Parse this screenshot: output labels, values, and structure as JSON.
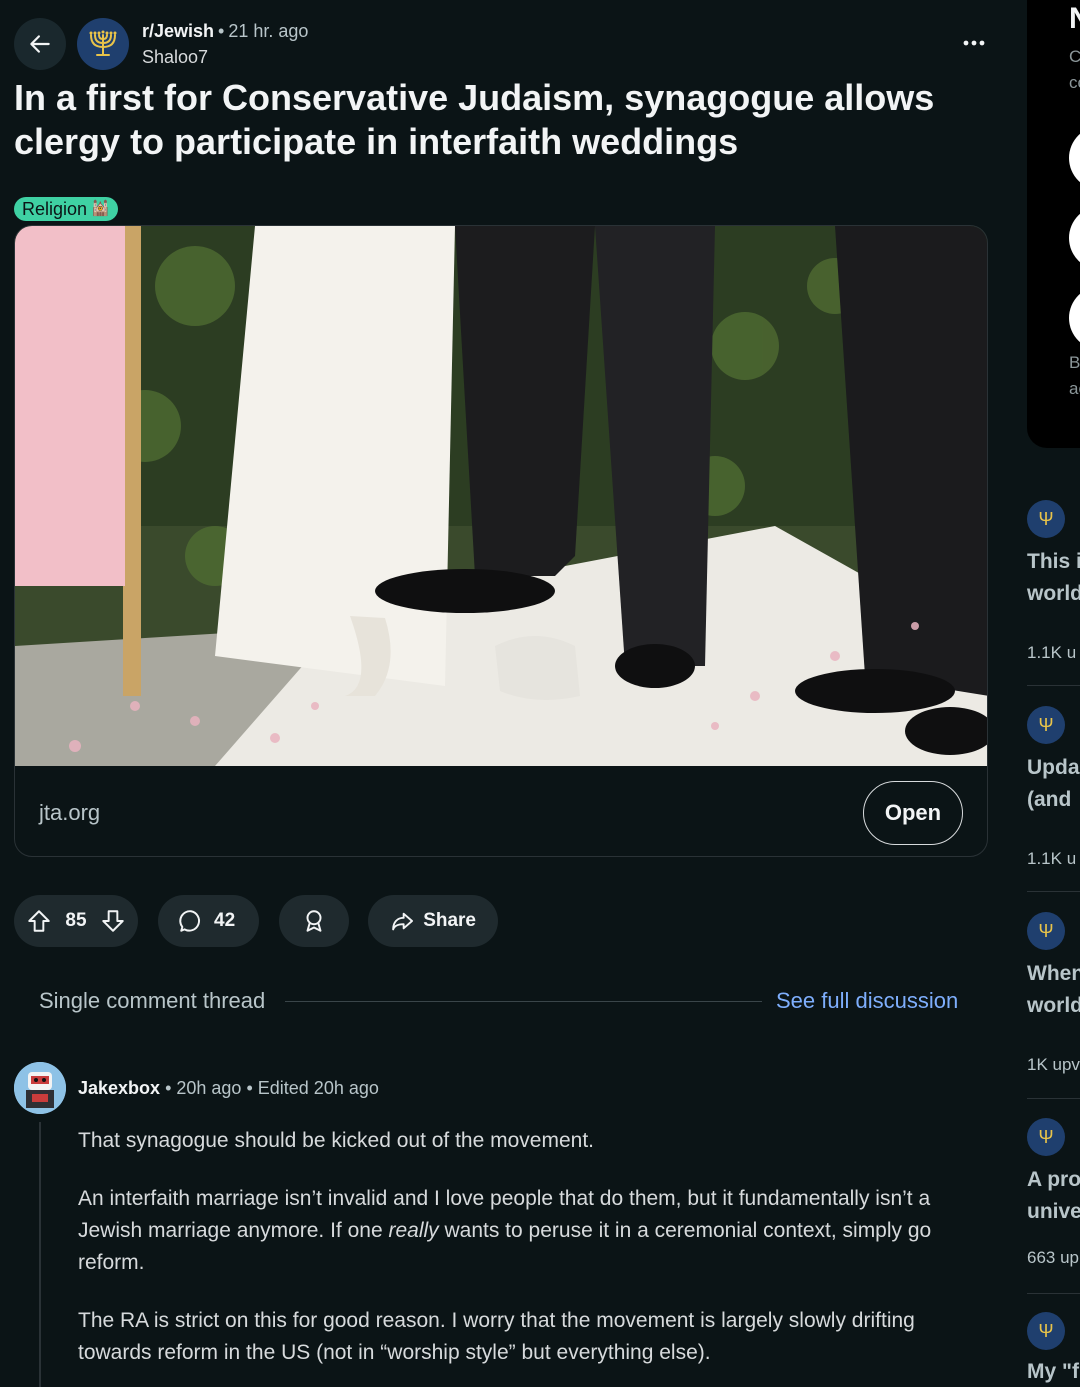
{
  "post": {
    "subreddit": "r/Jewish",
    "time_ago": "21 hr. ago",
    "author": "Shaloo7",
    "title": "In a first for Conservative Judaism, synagogue allows clergy to participate in interfaith weddings",
    "flair": "Religion",
    "flair_emoji": "🕍",
    "link_domain": "jta.org",
    "open_label": "Open",
    "score": "85",
    "comment_count": "42",
    "share_label": "Share"
  },
  "thread": {
    "label": "Single comment thread",
    "see_full_label": "See full discussion"
  },
  "comment": {
    "user": "Jakexbox",
    "time_ago": "20h ago",
    "edited": "Edited 20h ago",
    "p1": "That synagogue should be kicked out of the movement.",
    "p2_before": "An interfaith marriage isn’t invalid and I love people that do them, but it fundamentally isn’t a Jewish marriage anymore. If one ",
    "p2_em": "really",
    "p2_after": " wants to peruse it in a ceremonial context, simply go reform.",
    "p3": "The RA is strict on this for good reason. I worry that the movement is largely slowly drifting towards reform in the US (not in “worship style” but everything else)."
  },
  "sidebar": {
    "signup_title": "Ne",
    "signup_line1": "Cre",
    "signup_line2": "cor",
    "legal_line1": "By",
    "legal_line2": "ack",
    "related": [
      {
        "title1": "This i",
        "title2": "world",
        "stat": "1.1K u"
      },
      {
        "title1": "Upda",
        "title2": "(and",
        "stat": "1.1K u"
      },
      {
        "title1": "When",
        "title2": "world",
        "stat": "1K upv"
      },
      {
        "title1": "A pro",
        "title2": "unive",
        "stat": "663 up"
      },
      {
        "title1": "My \"f",
        "title2": "",
        "stat": ""
      }
    ]
  },
  "colors": {
    "background": "#0b1416",
    "flair": "#3fd1a3",
    "link": "#7eaefc",
    "subreddit_icon": "#1f3f6e",
    "menorah": "#e8c34a"
  },
  "icons": [
    "back-arrow-icon",
    "menorah-icon",
    "more-icon",
    "upvote-icon",
    "downvote-icon",
    "comment-icon",
    "award-icon",
    "share-icon"
  ]
}
